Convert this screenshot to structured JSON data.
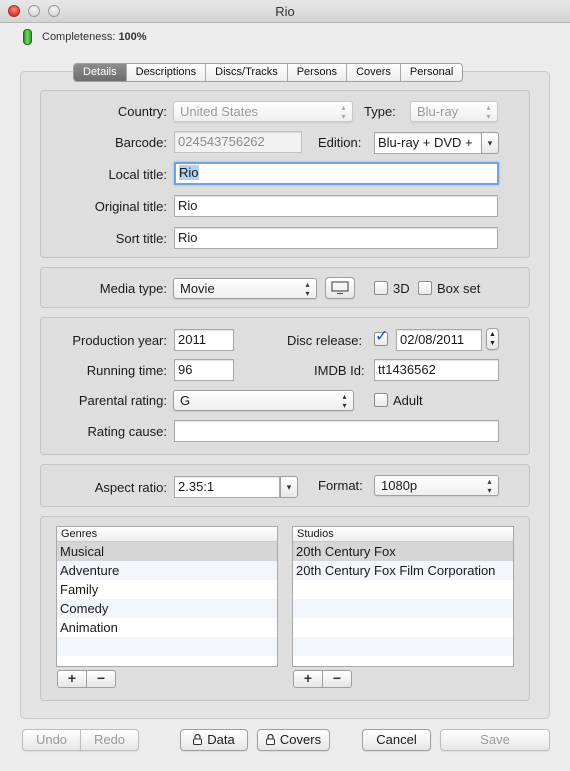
{
  "window": {
    "title": "Rio"
  },
  "status": {
    "label": "Completeness:",
    "value": "100%"
  },
  "tabs": [
    "Details",
    "Descriptions",
    "Discs/Tracks",
    "Persons",
    "Covers",
    "Personal"
  ],
  "details": {
    "country_label": "Country:",
    "country_value": "United States",
    "type_label": "Type:",
    "type_value": "Blu-ray",
    "barcode_label": "Barcode:",
    "barcode_value": "024543756262",
    "edition_label": "Edition:",
    "edition_value": "Blu-ray + DVD +",
    "local_title_label": "Local title:",
    "local_title_value": "Rio",
    "original_title_label": "Original title:",
    "original_title_value": "Rio",
    "sort_title_label": "Sort title:",
    "sort_title_value": "Rio"
  },
  "media": {
    "media_type_label": "Media type:",
    "media_type_value": "Movie",
    "three_d_label": "3D",
    "box_set_label": "Box set"
  },
  "production": {
    "year_label": "Production year:",
    "year_value": "2011",
    "disc_release_label": "Disc release:",
    "disc_release_value": "02/08/2011",
    "running_time_label": "Running time:",
    "running_time_value": "96",
    "imdb_label": "IMDB Id:",
    "imdb_value": "tt1436562",
    "parental_label": "Parental rating:",
    "parental_value": "G",
    "adult_label": "Adult",
    "rating_cause_label": "Rating cause:",
    "rating_cause_value": ""
  },
  "format": {
    "aspect_label": "Aspect ratio:",
    "aspect_value": "2.35:1",
    "format_label": "Format:",
    "format_value": "1080p"
  },
  "genres": {
    "header": "Genres",
    "items": [
      "Musical",
      "Adventure",
      "Family",
      "Comedy",
      "Animation"
    ]
  },
  "studios": {
    "header": "Studios",
    "items": [
      "20th Century Fox",
      "20th Century Fox Film Corporation"
    ]
  },
  "plus_minus": {
    "plus": "+",
    "minus": "−"
  },
  "footer": {
    "undo": "Undo",
    "redo": "Redo",
    "data": "Data",
    "covers": "Covers",
    "cancel": "Cancel",
    "save": "Save"
  },
  "icons": {
    "arrows": "▴▾",
    "combo_arrow": "▾",
    "check": "✓"
  }
}
